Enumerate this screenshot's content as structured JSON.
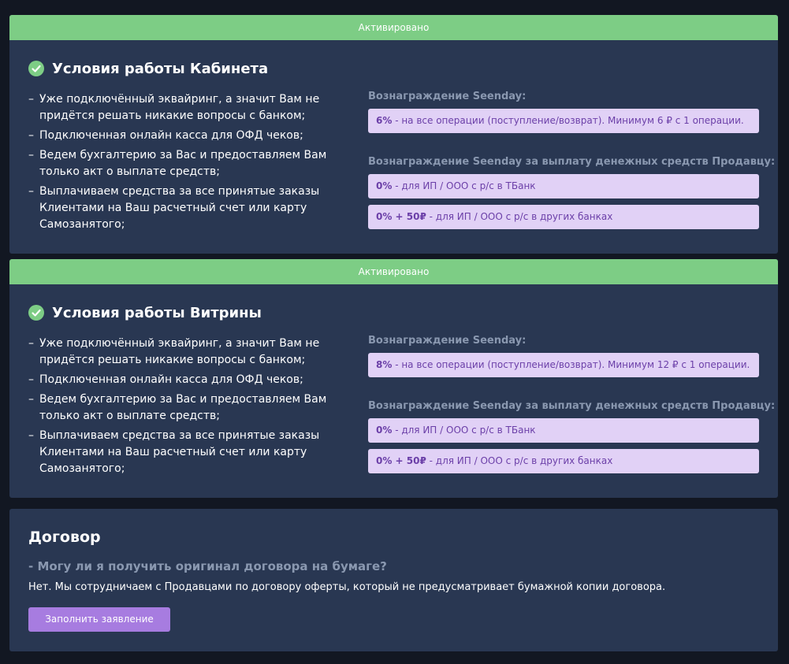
{
  "colors": {
    "background": "#121722",
    "card": "#293752",
    "banner": "#7dcd85",
    "fee_box": "#e1d1f6",
    "fee_text": "#6b3fa8",
    "muted_text": "#8a98b0",
    "button": "#a77ce0"
  },
  "cabinet": {
    "banner": "Активировано",
    "icon": "check-circle-icon",
    "title": "Условия работы Кабинета",
    "conditions": [
      "Уже подключённый эквайринг, а значит Вам не придётся решать никакие вопросы с банком;",
      "Подключенная онлайн касса для ОФД чеков;",
      "Ведем бухгалтерию за Вас и предоставляем Вам только акт о выплате средств;",
      "Выплачиваем средства за все принятые заказы Клиентами на Ваш расчетный счет или карту Самозанятого;"
    ],
    "reward_label": "Вознаграждение Seenday:",
    "reward": {
      "value": "6%",
      "text": " - на все операции (поступление/возврат). Минимум 6 ₽ с 1 операции."
    },
    "payout_label": "Вознаграждение Seenday за выплату денежных средств Продавцу:",
    "payouts": [
      {
        "value": "0%",
        "text": " - для ИП / ООО с р/с в ТБанк"
      },
      {
        "value": "0% + 50₽",
        "text": " - для ИП / ООО с р/с в других банках"
      }
    ]
  },
  "showcase": {
    "banner": "Активировано",
    "icon": "check-circle-icon",
    "title": "Условия работы Витрины",
    "conditions": [
      "Уже подключённый эквайринг, а значит Вам не придётся решать никакие вопросы с банком;",
      "Подключенная онлайн касса для ОФД чеков;",
      "Ведем бухгалтерию за Вас и предоставляем Вам только акт о выплате средств;",
      "Выплачиваем средства за все принятые заказы Клиентами на Ваш расчетный счет или карту Самозанятого;"
    ],
    "reward_label": "Вознаграждение Seenday:",
    "reward": {
      "value": "8%",
      "text": " - на все операции (поступление/возврат). Минимум 12 ₽ с 1 операции."
    },
    "payout_label": "Вознаграждение Seenday за выплату денежных средств Продавцу:",
    "payouts": [
      {
        "value": "0%",
        "text": " - для ИП / ООО с р/с в ТБанк"
      },
      {
        "value": "0% + 50₽",
        "text": " - для ИП / ООО с р/с в других банках"
      }
    ]
  },
  "contract": {
    "title": "Договор",
    "question": "- Могу ли я получить оригинал договора на бумаге?",
    "answer": "Нет. Мы сотрудничаем с Продавцами по договору оферты, который не предусматривает бумажной копии договора.",
    "button": "Заполнить заявление"
  }
}
